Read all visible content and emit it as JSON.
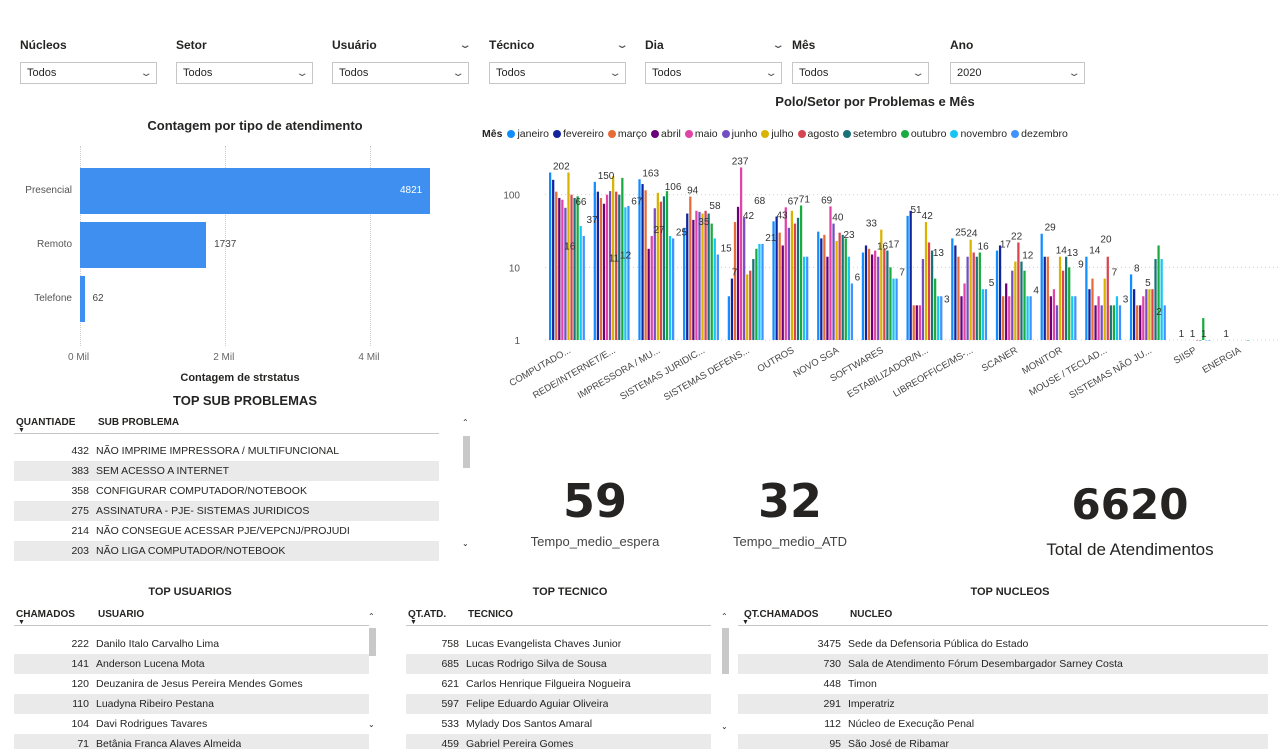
{
  "filters": [
    {
      "label": "Núcleos",
      "value": "Todos"
    },
    {
      "label": "Setor",
      "value": "Todos"
    },
    {
      "label": "Usuário",
      "value": "Todos"
    },
    {
      "label": "Técnico",
      "value": "Todos"
    },
    {
      "label": "Dia",
      "value": "Todos"
    },
    {
      "label": "Mês",
      "value": "Todos"
    },
    {
      "label": "Ano",
      "value": "2020"
    }
  ],
  "chart_data": [
    {
      "type": "bar",
      "orientation": "horizontal",
      "title": "Contagem por tipo de atendimento",
      "xlabel": "Contagem de strstatus",
      "categories": [
        "Presencial",
        "Remoto",
        "Telefone"
      ],
      "values": [
        4821,
        1737,
        62
      ],
      "xticks": [
        "0 Mil",
        "2 Mil",
        "4 Mil"
      ],
      "xlim": [
        0,
        5000
      ],
      "bar_color": "#3f8ff0"
    },
    {
      "type": "bar",
      "title": "Polo/Setor por Problemas e Mês",
      "legend_title": "Mês",
      "legend_position": "top",
      "yscale": "log",
      "yticks": [
        "1",
        "10",
        "100"
      ],
      "ylim": [
        1,
        300
      ],
      "categories": [
        "COMPUTADO...",
        "REDE/INTERNET/E...",
        "IMPRESSORA / MU...",
        "SISTEMAS JURIDIC...",
        "SISTEMAS DEFENS...",
        "OUTROS",
        "NOVO SGA",
        "SOFTWARES",
        "ESTABILIZADOR/N...",
        "LIBREOFFICE/MS-...",
        "SCANER",
        "MONITOR",
        "MOUSE / TECLAD...",
        "SISTEMAS NÃO JU...",
        "SIISP",
        "ENERGIA"
      ],
      "series": [
        {
          "name": "janeiro",
          "color": "#118dff",
          "values": [
            202,
            150,
            163,
            35,
            4,
            43,
            31,
            16,
            51,
            25,
            17,
            29,
            14,
            8,
            null,
            null
          ]
        },
        {
          "name": "fevereiro",
          "color": "#12239e",
          "values": [
            160,
            110,
            140,
            55,
            7,
            50,
            25,
            20,
            60,
            20,
            20,
            14,
            5,
            5,
            null,
            null
          ]
        },
        {
          "name": "março",
          "color": "#e66c37",
          "values": [
            110,
            90,
            115,
            94,
            42,
            30,
            28,
            18,
            3,
            14,
            4,
            14,
            7,
            3,
            null,
            null
          ]
        },
        {
          "name": "abril",
          "color": "#6b007b",
          "values": [
            90,
            75,
            18,
            45,
            68,
            20,
            14,
            15,
            3,
            4,
            6,
            4,
            3,
            3,
            null,
            null
          ]
        },
        {
          "name": "maio",
          "color": "#e044a7",
          "values": [
            85,
            100,
            27,
            60,
            237,
            67,
            69,
            17,
            3,
            6,
            4,
            5,
            4,
            4,
            null,
            null
          ]
        },
        {
          "name": "junho",
          "color": "#744ec2",
          "values": [
            66,
            112,
            65,
            58,
            48,
            35,
            40,
            14,
            13,
            14,
            9,
            3,
            3,
            5,
            null,
            null
          ]
        },
        {
          "name": "julho",
          "color": "#d9b300",
          "values": [
            202,
            180,
            106,
            55,
            8,
            60,
            23,
            33,
            42,
            24,
            12,
            14,
            7,
            5,
            null,
            null
          ]
        },
        {
          "name": "agosto",
          "color": "#d64550",
          "values": [
            100,
            110,
            80,
            60,
            9,
            40,
            30,
            18,
            22,
            16,
            22,
            9,
            14,
            5,
            1,
            null
          ]
        },
        {
          "name": "setembro",
          "color": "#197278",
          "values": [
            90,
            100,
            95,
            55,
            13,
            48,
            28,
            17,
            17,
            14,
            12,
            14,
            3,
            13,
            1,
            null
          ]
        },
        {
          "name": "outubro",
          "color": "#1aab40",
          "values": [
            95,
            170,
            112,
            40,
            18,
            71,
            25,
            10,
            7,
            16,
            9,
            10,
            3,
            20,
            2,
            1
          ]
        },
        {
          "name": "novembro",
          "color": "#15c6f4",
          "values": [
            37,
            67,
            27,
            25,
            21,
            14,
            14,
            7,
            4,
            5,
            4,
            4,
            4,
            13,
            1,
            null
          ]
        },
        {
          "name": "dezembro",
          "color": "#4092ff",
          "values": [
            27,
            70,
            25,
            15,
            21,
            14,
            6,
            7,
            4,
            5,
            4,
            4,
            3,
            3,
            1,
            null
          ]
        }
      ],
      "data_labels": [
        {
          "category": 0,
          "text": "202"
        },
        {
          "category": 0,
          "text": "16"
        },
        {
          "category": 0,
          "text": "66"
        },
        {
          "category": 0,
          "text": "37"
        },
        {
          "category": 1,
          "text": "150"
        },
        {
          "category": 1,
          "text": "11"
        },
        {
          "category": 1,
          "text": "12"
        },
        {
          "category": 1,
          "text": "67"
        },
        {
          "category": 2,
          "text": "163"
        },
        {
          "category": 2,
          "text": "27"
        },
        {
          "category": 2,
          "text": "106"
        },
        {
          "category": 2,
          "text": "25"
        },
        {
          "category": 3,
          "text": "94"
        },
        {
          "category": 3,
          "text": "35"
        },
        {
          "category": 3,
          "text": "58"
        },
        {
          "category": 3,
          "text": "15"
        },
        {
          "category": 4,
          "text": "237"
        },
        {
          "category": 4,
          "text": "42"
        },
        {
          "category": 4,
          "text": "68"
        },
        {
          "category": 4,
          "text": "21"
        },
        {
          "category": 4,
          "text": "7"
        },
        {
          "category": 5,
          "text": "43"
        },
        {
          "category": 5,
          "text": "67"
        },
        {
          "category": 5,
          "text": "71"
        },
        {
          "category": 6,
          "text": "69"
        },
        {
          "category": 6,
          "text": "40"
        },
        {
          "category": 6,
          "text": "23"
        },
        {
          "category": 6,
          "text": "6"
        },
        {
          "category": 7,
          "text": "33"
        },
        {
          "category": 7,
          "text": "16"
        },
        {
          "category": 7,
          "text": "17"
        },
        {
          "category": 7,
          "text": "7"
        },
        {
          "category": 8,
          "text": "51"
        },
        {
          "category": 8,
          "text": "42"
        },
        {
          "category": 8,
          "text": "13"
        },
        {
          "category": 8,
          "text": "3"
        },
        {
          "category": 9,
          "text": "25"
        },
        {
          "category": 9,
          "text": "24"
        },
        {
          "category": 9,
          "text": "16"
        },
        {
          "category": 9,
          "text": "5"
        },
        {
          "category": 10,
          "text": "17"
        },
        {
          "category": 10,
          "text": "22"
        },
        {
          "category": 10,
          "text": "12"
        },
        {
          "category": 10,
          "text": "4"
        },
        {
          "category": 11,
          "text": "29"
        },
        {
          "category": 11,
          "text": "14"
        },
        {
          "category": 11,
          "text": "13"
        },
        {
          "category": 11,
          "text": "9"
        },
        {
          "category": 12,
          "text": "14"
        },
        {
          "category": 12,
          "text": "20"
        },
        {
          "category": 12,
          "text": "7"
        },
        {
          "category": 12,
          "text": "3"
        },
        {
          "category": 13,
          "text": "8"
        },
        {
          "category": 13,
          "text": "5"
        },
        {
          "category": 13,
          "text": "2"
        },
        {
          "category": 14,
          "text": "1"
        },
        {
          "category": 14,
          "text": "1"
        },
        {
          "category": 14,
          "text": "1"
        },
        {
          "category": 15,
          "text": "1"
        }
      ]
    }
  ],
  "sub_problemas": {
    "title": "TOP SUB PROBLEMAS",
    "col1": "QUANTIADE",
    "col2": "SUB PROBLEMA",
    "rows": [
      {
        "n": "432",
        "t": "NÃO IMPRIME IMPRESSORA / MULTIFUNCIONAL"
      },
      {
        "n": "383",
        "t": "SEM ACESSO A INTERNET"
      },
      {
        "n": "358",
        "t": "CONFIGURAR COMPUTADOR/NOTEBOOK"
      },
      {
        "n": "275",
        "t": "ASSINATURA - PJE- SISTEMAS JURIDICOS"
      },
      {
        "n": "214",
        "t": "NÃO CONSEGUE ACESSAR PJE/VEPCNJ/PROJUDI"
      },
      {
        "n": "203",
        "t": "NÃO LIGA COMPUTADOR/NOTEBOOK"
      }
    ]
  },
  "kpis": [
    {
      "value": "59",
      "caption": "Tempo_medio_espera"
    },
    {
      "value": "32",
      "caption": "Tempo_medio_ATD"
    },
    {
      "value": "6620",
      "caption": "Total de Atendimentos"
    }
  ],
  "usuarios": {
    "title": "TOP USUARIOS",
    "col1": "CHAMADOS",
    "col2": "USUÁRIO",
    "rows": [
      {
        "n": "222",
        "t": "Danilo Italo Carvalho Lima"
      },
      {
        "n": "141",
        "t": "Anderson Lucena Mota"
      },
      {
        "n": "120",
        "t": "Deuzanira de Jesus Pereira Mendes Gomes"
      },
      {
        "n": "110",
        "t": "Luadyna Ribeiro Pestana"
      },
      {
        "n": "104",
        "t": "Davi Rodrigues Tavares"
      },
      {
        "n": "71",
        "t": "Betânia Franca Alaves Almeida"
      }
    ]
  },
  "tecnicos": {
    "title": "TOP TECNICO",
    "col1": "QT.ATD.",
    "col2": "TECNICO",
    "rows": [
      {
        "n": "758",
        "t": "Lucas Evangelista Chaves Junior"
      },
      {
        "n": "685",
        "t": "Lucas Rodrigo Silva de Sousa"
      },
      {
        "n": "621",
        "t": "Carlos Henrique Filgueira Nogueira"
      },
      {
        "n": "597",
        "t": "Felipe Eduardo Aguiar Oliveira"
      },
      {
        "n": "533",
        "t": "Mylady Dos Santos Amaral"
      },
      {
        "n": "459",
        "t": "Gabriel Pereira Gomes"
      }
    ]
  },
  "nucleos": {
    "title": "TOP NUCLEOS",
    "col1": "QT.CHAMADOS",
    "col2": "NUCLEO",
    "rows": [
      {
        "n": "3475",
        "t": "Sede da Defensoria Pública do Estado"
      },
      {
        "n": "730",
        "t": "Sala de Atendimento Fórum Desembargador Sarney Costa"
      },
      {
        "n": "448",
        "t": "Timon"
      },
      {
        "n": "291",
        "t": "Imperatriz"
      },
      {
        "n": "112",
        "t": "Núcleo de Execução Penal"
      },
      {
        "n": "95",
        "t": "São José de Ribamar"
      }
    ]
  }
}
